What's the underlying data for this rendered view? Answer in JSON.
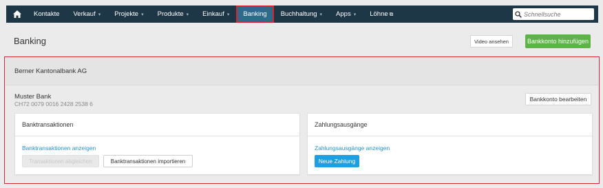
{
  "nav": {
    "home_icon": "home-icon",
    "items": [
      {
        "label": "Kontakte",
        "dropdown": false
      },
      {
        "label": "Verkauf",
        "dropdown": true
      },
      {
        "label": "Projekte",
        "dropdown": true
      },
      {
        "label": "Produkte",
        "dropdown": true
      },
      {
        "label": "Einkauf",
        "dropdown": true
      },
      {
        "label": "Banking",
        "dropdown": false,
        "active": true
      },
      {
        "label": "Buchhaltung",
        "dropdown": true
      },
      {
        "label": "Apps",
        "dropdown": true
      },
      {
        "label": "Löhne",
        "dropdown": false,
        "external": true
      }
    ],
    "caret": "▾",
    "external_glyph": "⧉",
    "search_placeholder": "Schnellsuche"
  },
  "page": {
    "title": "Banking",
    "video_button": "Video ansehen",
    "add_account_button": "Bankkonto hinzufügen"
  },
  "bank": {
    "name": "Berner Kantonalbank AG",
    "account_name": "Muster Bank",
    "iban": "CH72 0079 0016 2428 2538 6",
    "edit_button": "Bankkonto bearbeiten",
    "transactions_card": {
      "title": "Banktransaktionen",
      "link": "Banktransaktionen anzeigen",
      "reconcile_button": "Transaktionen abgleichen",
      "import_button": "Banktransaktionen importieren"
    },
    "payments_card": {
      "title": "Zahlungsausgänge",
      "link": "Zahlungsausgänge anzeigen",
      "new_payment_button": "Neue Zahlung"
    }
  },
  "colors": {
    "nav_bg": "#1e3747",
    "active_tab": "#2d6a8c",
    "highlight_border": "#d9262e",
    "primary_green": "#5cb346",
    "link_blue": "#2196d4",
    "button_blue": "#1f9fe0"
  }
}
